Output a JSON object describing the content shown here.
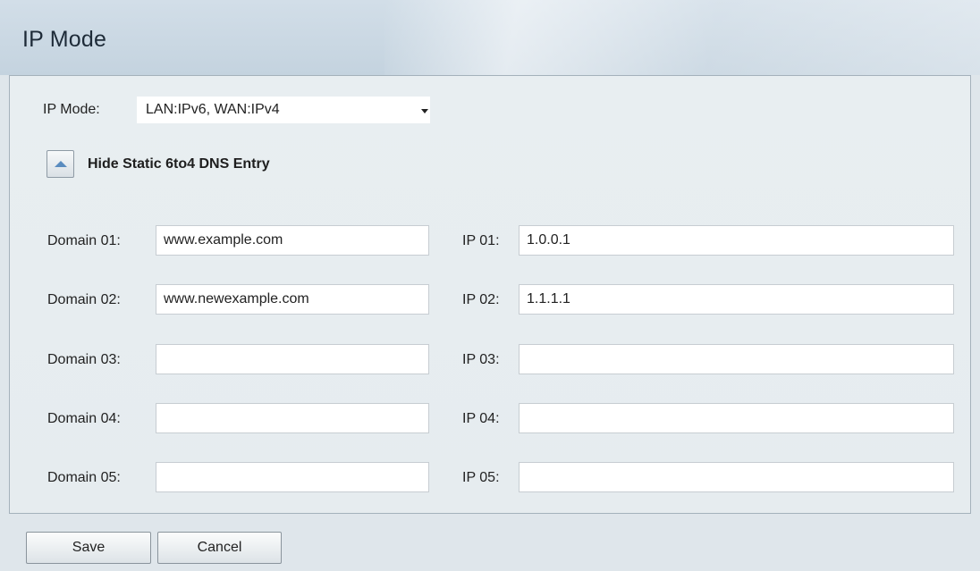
{
  "page": {
    "title": "IP Mode"
  },
  "ip_mode": {
    "label": "IP Mode:",
    "selected": "LAN:IPv6, WAN:IPv4"
  },
  "dns_toggle": {
    "label": "Hide Static 6to4 DNS Entry"
  },
  "entries": [
    {
      "domain_label": "Domain 01:",
      "domain_value": "www.example.com",
      "ip_label": "IP 01:",
      "ip_value": "1.0.0.1"
    },
    {
      "domain_label": "Domain 02:",
      "domain_value": "www.newexample.com",
      "ip_label": "IP 02:",
      "ip_value": "1.1.1.1"
    },
    {
      "domain_label": "Domain 03:",
      "domain_value": "",
      "ip_label": "IP 03:",
      "ip_value": ""
    },
    {
      "domain_label": "Domain 04:",
      "domain_value": "",
      "ip_label": "IP 04:",
      "ip_value": ""
    },
    {
      "domain_label": "Domain 05:",
      "domain_value": "",
      "ip_label": "IP 05:",
      "ip_value": ""
    }
  ],
  "buttons": {
    "save": "Save",
    "cancel": "Cancel"
  }
}
